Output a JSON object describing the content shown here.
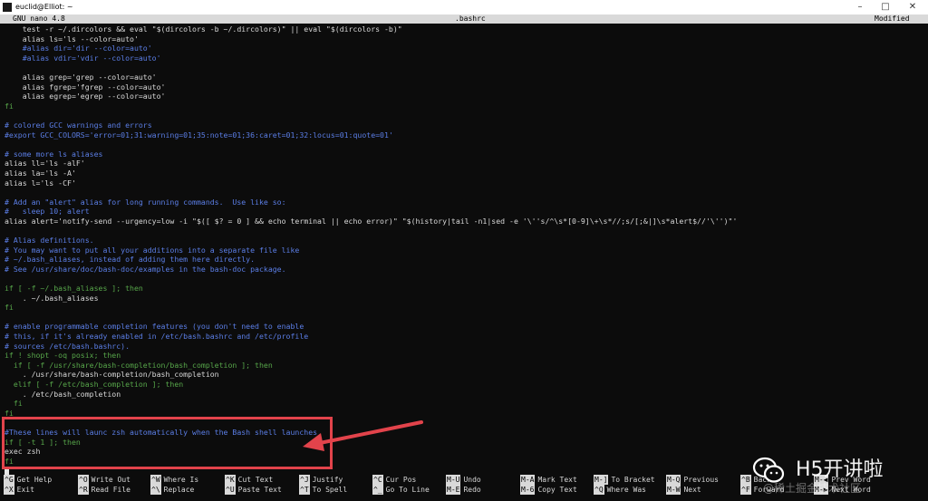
{
  "window": {
    "title": "euclid@Elliot: ~",
    "minimize_icon": "minimize-icon",
    "maximize_icon": "maximize-icon",
    "close_icon": "close-icon"
  },
  "nano_header": {
    "version": "GNU nano 4.8",
    "filename": ".bashrc",
    "status": "Modified"
  },
  "editor": {
    "lines": [
      {
        "text": "    test -r ~/.dircolors && eval \"$(dircolors -b ~/.dircolors)\" || eval \"$(dircolors -b)\"",
        "kind": "code"
      },
      {
        "text": "    alias ls='ls --color=auto'",
        "kind": "code"
      },
      {
        "text": "    #alias dir='dir --color=auto'",
        "kind": "comment"
      },
      {
        "text": "    #alias vdir='vdir --color=auto'",
        "kind": "comment"
      },
      {
        "text": "",
        "kind": "code"
      },
      {
        "text": "    alias grep='grep --color=auto'",
        "kind": "code"
      },
      {
        "text": "    alias fgrep='fgrep --color=auto'",
        "kind": "code"
      },
      {
        "text": "    alias egrep='egrep --color=auto'",
        "kind": "code"
      },
      {
        "text": "fi",
        "kind": "green"
      },
      {
        "text": "",
        "kind": "code"
      },
      {
        "text": "# colored GCC warnings and errors",
        "kind": "comment"
      },
      {
        "text": "#export GCC_COLORS='error=01;31:warning=01;35:note=01;36:caret=01;32:locus=01:quote=01'",
        "kind": "comment"
      },
      {
        "text": "",
        "kind": "code"
      },
      {
        "text": "# some more ls aliases",
        "kind": "comment"
      },
      {
        "text": "alias ll='ls -alF'",
        "kind": "code"
      },
      {
        "text": "alias la='ls -A'",
        "kind": "code"
      },
      {
        "text": "alias l='ls -CF'",
        "kind": "code"
      },
      {
        "text": "",
        "kind": "code"
      },
      {
        "text": "# Add an \"alert\" alias for long running commands.  Use like so:",
        "kind": "comment"
      },
      {
        "text": "#   sleep 10; alert",
        "kind": "comment"
      },
      {
        "text": "alias alert='notify-send --urgency=low -i \"$([ $? = 0 ] && echo terminal || echo error)\" \"$(history|tail -n1|sed -e '\\''s/^\\s*[0-9]\\+\\s*//;s/[;&|]\\s*alert$//'\\'')\"'",
        "kind": "code"
      },
      {
        "text": "",
        "kind": "code"
      },
      {
        "text": "# Alias definitions.",
        "kind": "comment"
      },
      {
        "text": "# You may want to put all your additions into a separate file like",
        "kind": "comment"
      },
      {
        "text": "# ~/.bash_aliases, instead of adding them here directly.",
        "kind": "comment"
      },
      {
        "text": "# See /usr/share/doc/bash-doc/examples in the bash-doc package.",
        "kind": "comment"
      },
      {
        "text": "",
        "kind": "code"
      },
      {
        "text": "if [ -f ~/.bash_aliases ]; then",
        "kind": "green"
      },
      {
        "text": "    . ~/.bash_aliases",
        "kind": "code"
      },
      {
        "text": "fi",
        "kind": "green"
      },
      {
        "text": "",
        "kind": "code"
      },
      {
        "text": "# enable programmable completion features (you don't need to enable",
        "kind": "comment"
      },
      {
        "text": "# this, if it's already enabled in /etc/bash.bashrc and /etc/profile",
        "kind": "comment"
      },
      {
        "text": "# sources /etc/bash.bashrc).",
        "kind": "comment"
      },
      {
        "text": "if ! shopt -oq posix; then",
        "kind": "green"
      },
      {
        "text": "  if [ -f /usr/share/bash-completion/bash_completion ]; then",
        "kind": "green"
      },
      {
        "text": "    . /usr/share/bash-completion/bash_completion",
        "kind": "code"
      },
      {
        "text": "  elif [ -f /etc/bash_completion ]; then",
        "kind": "green"
      },
      {
        "text": "    . /etc/bash_completion",
        "kind": "code"
      },
      {
        "text": "  fi",
        "kind": "green"
      },
      {
        "text": "fi",
        "kind": "green"
      },
      {
        "text": "",
        "kind": "code"
      },
      {
        "text": "#These lines will launc zsh automatically when the Bash shell launches",
        "kind": "comment"
      },
      {
        "text": "if [ -t 1 ]; then",
        "kind": "green"
      },
      {
        "text": "exec zsh",
        "kind": "code"
      },
      {
        "text": "fi",
        "kind": "green"
      }
    ]
  },
  "shortcuts": [
    {
      "key1": "^G",
      "label1": "Get Help",
      "key2": "^X",
      "label2": "Exit"
    },
    {
      "key1": "^O",
      "label1": "Write Out",
      "key2": "^R",
      "label2": "Read File"
    },
    {
      "key1": "^W",
      "label1": "Where Is",
      "key2": "^\\",
      "label2": "Replace"
    },
    {
      "key1": "^K",
      "label1": "Cut Text",
      "key2": "^U",
      "label2": "Paste Text"
    },
    {
      "key1": "^J",
      "label1": "Justify",
      "key2": "^T",
      "label2": "To Spell"
    },
    {
      "key1": "^C",
      "label1": "Cur Pos",
      "key2": "^_",
      "label2": "Go To Line"
    },
    {
      "key1": "M-U",
      "label1": "Undo",
      "key2": "M-E",
      "label2": "Redo"
    },
    {
      "key1": "M-A",
      "label1": "Mark Text",
      "key2": "M-6",
      "label2": "Copy Text"
    },
    {
      "key1": "M-]",
      "label1": "To Bracket",
      "key2": "^Q",
      "label2": "Where Was"
    },
    {
      "key1": "M-Q",
      "label1": "Previous",
      "key2": "M-W",
      "label2": "Next"
    },
    {
      "key1": "^B",
      "label1": "Back",
      "key2": "^F",
      "label2": "Forward"
    },
    {
      "key1": "M-◀",
      "label1": "Prev Word",
      "key2": "M-▶",
      "label2": "Next Word"
    }
  ],
  "watermark": {
    "brand": "H5开讲啦",
    "sub": "@稀土掘金技术社区",
    "icon": "wechat-icon"
  },
  "colors": {
    "comment": "#5b7ee6",
    "keyword": "#57a64a",
    "annotation": "#e2434b"
  }
}
